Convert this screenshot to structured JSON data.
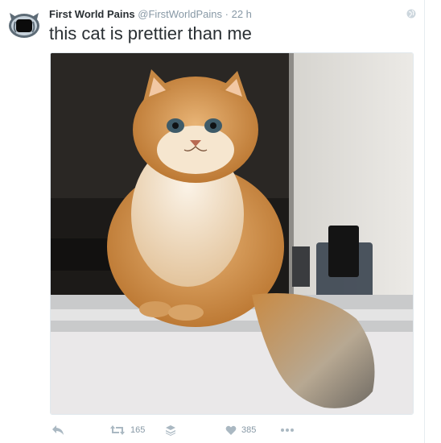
{
  "tweet": {
    "display_name": "First World Pains",
    "handle": "@FirstWorldPains",
    "separator": "·",
    "time": "22 h",
    "text": "this cat is prettier than me"
  },
  "actions": {
    "retweet_count": "165",
    "like_count": "385"
  },
  "icons": {
    "reply": "reply-icon",
    "retweet": "retweet-icon",
    "buffer": "buffer-icon",
    "like": "heart-icon",
    "more": "more-dots-icon",
    "globe": "globe-icon"
  },
  "colors": {
    "name": "#292f33",
    "meta": "#8899a6",
    "icon": "#aab8c2",
    "border": "#e1e8ed"
  }
}
